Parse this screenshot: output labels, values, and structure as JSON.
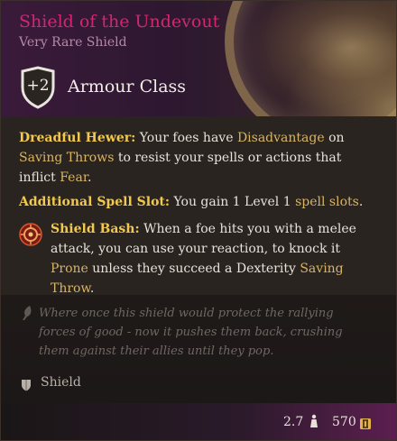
{
  "item": {
    "name": "Shield of the Undevout",
    "rarity": "Very Rare Shield",
    "armour_class_value": "+2",
    "armour_class_label": "Armour Class"
  },
  "properties": {
    "dreadful_hewer": {
      "name": "Dreadful Hewer:",
      "t1": " Your foes have ",
      "term1": "Disadvantage",
      "t2": " on ",
      "term2": "Saving Throws",
      "t3": " to resist your spells or actions that inflict ",
      "term3": "Fear",
      "t4": "."
    },
    "spell_slot": {
      "name": "Additional Spell Slot:",
      "t1": " You gain 1 Level 1 ",
      "term1": "spell slots",
      "t2": "."
    },
    "shield_bash": {
      "name": "Shield Bash:",
      "t1": " When a foe hits you with a melee attack, you can use your reaction, to knock it ",
      "term1": "Prone",
      "t2": " unless they succeed a Dexterity ",
      "term2": "Saving Throw",
      "t3": "."
    }
  },
  "flavor_text": "Where once this shield would protect the rallying forces of good - now it pushes them back, crushing them against their allies until they pop.",
  "item_type": "Shield",
  "footer": {
    "weight": "2.7",
    "value": "570"
  },
  "colors": {
    "title": "#d4266f",
    "keyword": "#f2c94c",
    "term": "#d8b465"
  },
  "icons": {
    "armour_class": "shield-badge-icon",
    "shield_bash": "shield-bash-icon",
    "flavor": "quill-icon",
    "item_type": "shield-icon",
    "weight": "weight-icon",
    "value": "gold-coin-icon"
  }
}
